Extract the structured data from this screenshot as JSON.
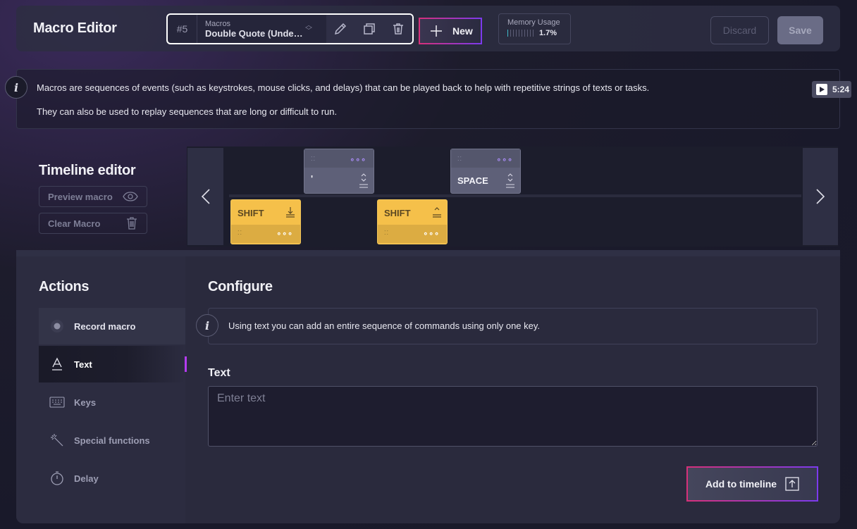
{
  "header": {
    "title": "Macro Editor",
    "macro_number": "#5",
    "macro_label": "Macros",
    "macro_name": "Double Quote (Undeadkey)",
    "new_label": "New",
    "memory_label": "Memory Usage",
    "memory_value": "1.7%",
    "memory_fraction": 0.017,
    "discard_label": "Discard",
    "save_label": "Save"
  },
  "info": {
    "line1": "Macros are sequences of events (such as keystrokes, mouse clicks, and delays) that can be played back to help with repetitive strings of texts or tasks.",
    "line2": "They can also be used to replay sequences that are long or difficult to run.",
    "video_duration": "5:24"
  },
  "timeline": {
    "title": "Timeline editor",
    "preview_label": "Preview macro",
    "clear_label": "Clear Macro",
    "events": [
      {
        "key": "SHIFT",
        "action": "key-down",
        "color": "yellow"
      },
      {
        "key": "'",
        "action": "key-press",
        "color": "gray"
      },
      {
        "key": "SHIFT",
        "action": "key-up",
        "color": "yellow"
      },
      {
        "key": "SPACE",
        "action": "key-press",
        "color": "gray"
      }
    ]
  },
  "actions": {
    "title": "Actions",
    "items": [
      {
        "label": "Record macro",
        "icon": "record-icon"
      },
      {
        "label": "Text",
        "icon": "text-icon"
      },
      {
        "label": "Keys",
        "icon": "keyboard-icon"
      },
      {
        "label": "Special functions",
        "icon": "magic-wand-icon"
      },
      {
        "label": "Delay",
        "icon": "stopwatch-icon"
      }
    ],
    "active": "Text"
  },
  "configure": {
    "title": "Configure",
    "info": "Using text you can add an entire sequence of commands using only one key.",
    "text_label": "Text",
    "text_placeholder": "Enter text",
    "text_value": "",
    "add_label": "Add to timeline"
  },
  "colors": {
    "accent_pink": "#d6307a",
    "accent_purple": "#7c3aed",
    "key_yellow": "#f5c04a",
    "key_gray": "#5e6078",
    "memory_bar": "#3fb9c8"
  }
}
